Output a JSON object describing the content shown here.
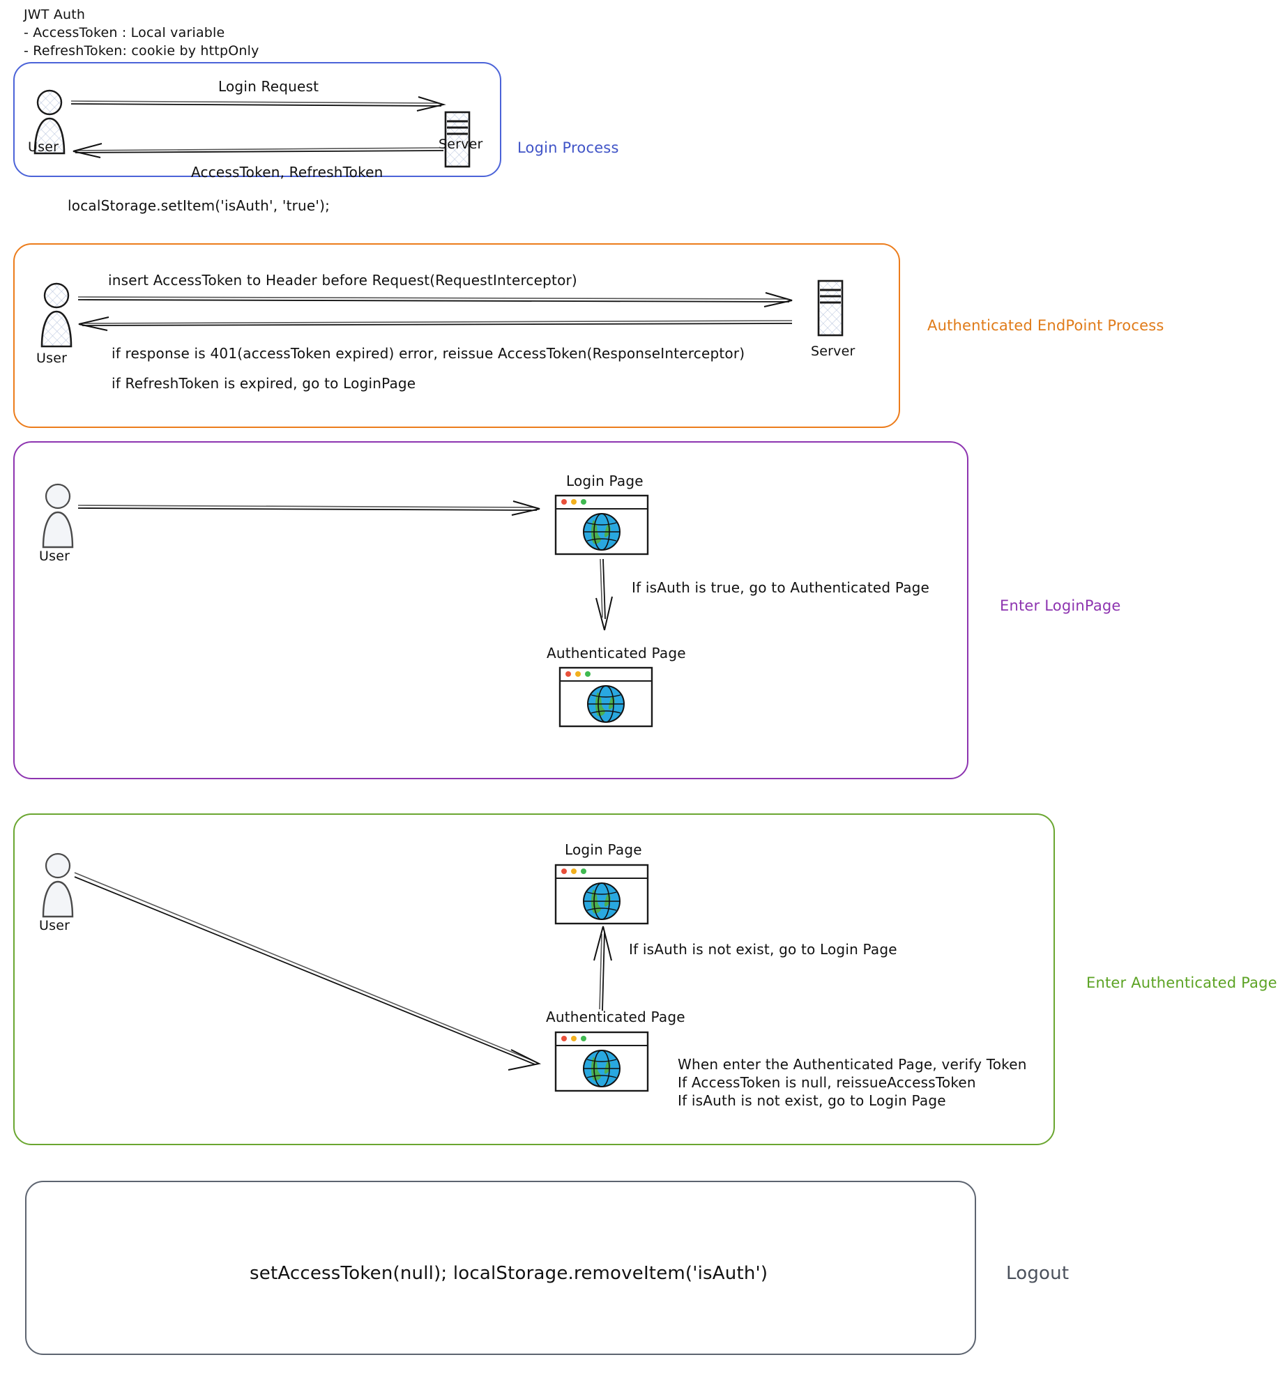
{
  "header": {
    "title": "JWT Auth",
    "bullets": [
      "- AccessToken : Local variable",
      "- RefreshToken: cookie by httpOnly"
    ]
  },
  "colors": {
    "login_process": "#4b63d8",
    "authenticated_endpoint": "#ec7c1b",
    "enter_loginpage": "#8d34b0",
    "enter_authenticated": "#6aa630",
    "logout": "#5d6470",
    "browser_dot_red": "#e8503a",
    "browser_dot_yellow": "#f2b01e",
    "browser_dot_green": "#3fb950",
    "globe_water": "#29a8e0",
    "globe_land": "#4caf50"
  },
  "sections": {
    "login_process": {
      "tag": "Login Process",
      "actor_label": "User",
      "server_label": "Server",
      "arrow_request": "Login Request",
      "arrow_response": "AccessToken, RefreshToken",
      "note": "localStorage.setItem('isAuth', 'true');"
    },
    "authenticated_endpoint": {
      "tag": "Authenticated EndPoint Process",
      "actor_label": "User",
      "server_label": "Server",
      "arrow_request": "insert AccessToken to Header before Request(RequestInterceptor)",
      "arrow_response": "if response is 401(accessToken expired) error, reissue AccessToken(ResponseInterceptor)",
      "note": "if RefreshToken is expired, go to LoginPage"
    },
    "enter_loginpage": {
      "tag": "Enter LoginPage",
      "actor_label": "User",
      "login_page_label": "Login Page",
      "authenticated_page_label": "Authenticated Page",
      "transition_note": "If isAuth is true, go to Authenticated Page"
    },
    "enter_authenticated": {
      "tag": "Enter Authenticated Page",
      "actor_label": "User",
      "login_page_label": "Login Page",
      "authenticated_page_label": "Authenticated Page",
      "transition_note": "If isAuth is not exist, go to Login Page",
      "notes": [
        "When enter the Authenticated Page, verify Token",
        "If AccessToken is null, reissueAccessToken",
        "If isAuth is not exist, go to Login Page"
      ]
    },
    "logout": {
      "tag": "Logout",
      "note": "setAccessToken(null); localStorage.removeItem('isAuth')"
    }
  },
  "icons": {
    "user": "user-actor-icon",
    "server": "server-icon",
    "browser_window": "browser-window-icon",
    "globe": "globe-icon"
  }
}
